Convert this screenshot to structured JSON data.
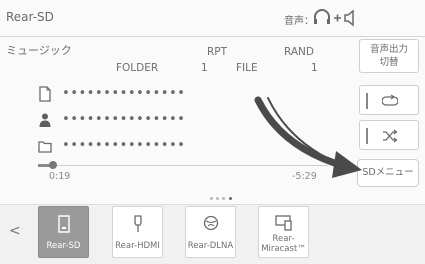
{
  "header": {
    "title": "Rear-SD",
    "audio_label": "音声：",
    "audio_icon": "headphones-plus-speaker-icon"
  },
  "source": {
    "type_label": "ミュージック",
    "rpt_label": "RPT",
    "rpt_value": "FOLDER",
    "rpt_number": "1",
    "rand_label": "RAND",
    "rand_value": "FILE",
    "rand_number": "1"
  },
  "track": {
    "rows": [
      {
        "icon": "file-icon",
        "text": "•••••••••••••••"
      },
      {
        "icon": "person-icon",
        "text": "•••••••••••••••"
      },
      {
        "icon": "folder-icon",
        "text": "•••••••••••••••"
      }
    ],
    "elapsed": "0:19",
    "remaining": "-5:29",
    "progress_fraction": 0.05
  },
  "side": {
    "audio_output_line1": "音声出力",
    "audio_output_line2": "切替",
    "repeat_icon": "repeat-icon",
    "shuffle_icon": "shuffle-icon",
    "sd_menu_label": "SDメニュー"
  },
  "sources": [
    {
      "label": "Rear-SD",
      "icon": "sd-card-icon",
      "active": true
    },
    {
      "label": "Rear-HDMI",
      "icon": "hdmi-plug-icon",
      "active": false
    },
    {
      "label": "Rear-DLNA",
      "icon": "globe-icon",
      "active": false
    },
    {
      "label_line1": "Rear-",
      "label_line2": "Miracast™",
      "icon": "miracast-screen-icon",
      "active": false
    }
  ],
  "colors": {
    "accent": "#6a6a6a",
    "active_tile": "#9a9a9a",
    "arrow": "#4a4a4a"
  }
}
